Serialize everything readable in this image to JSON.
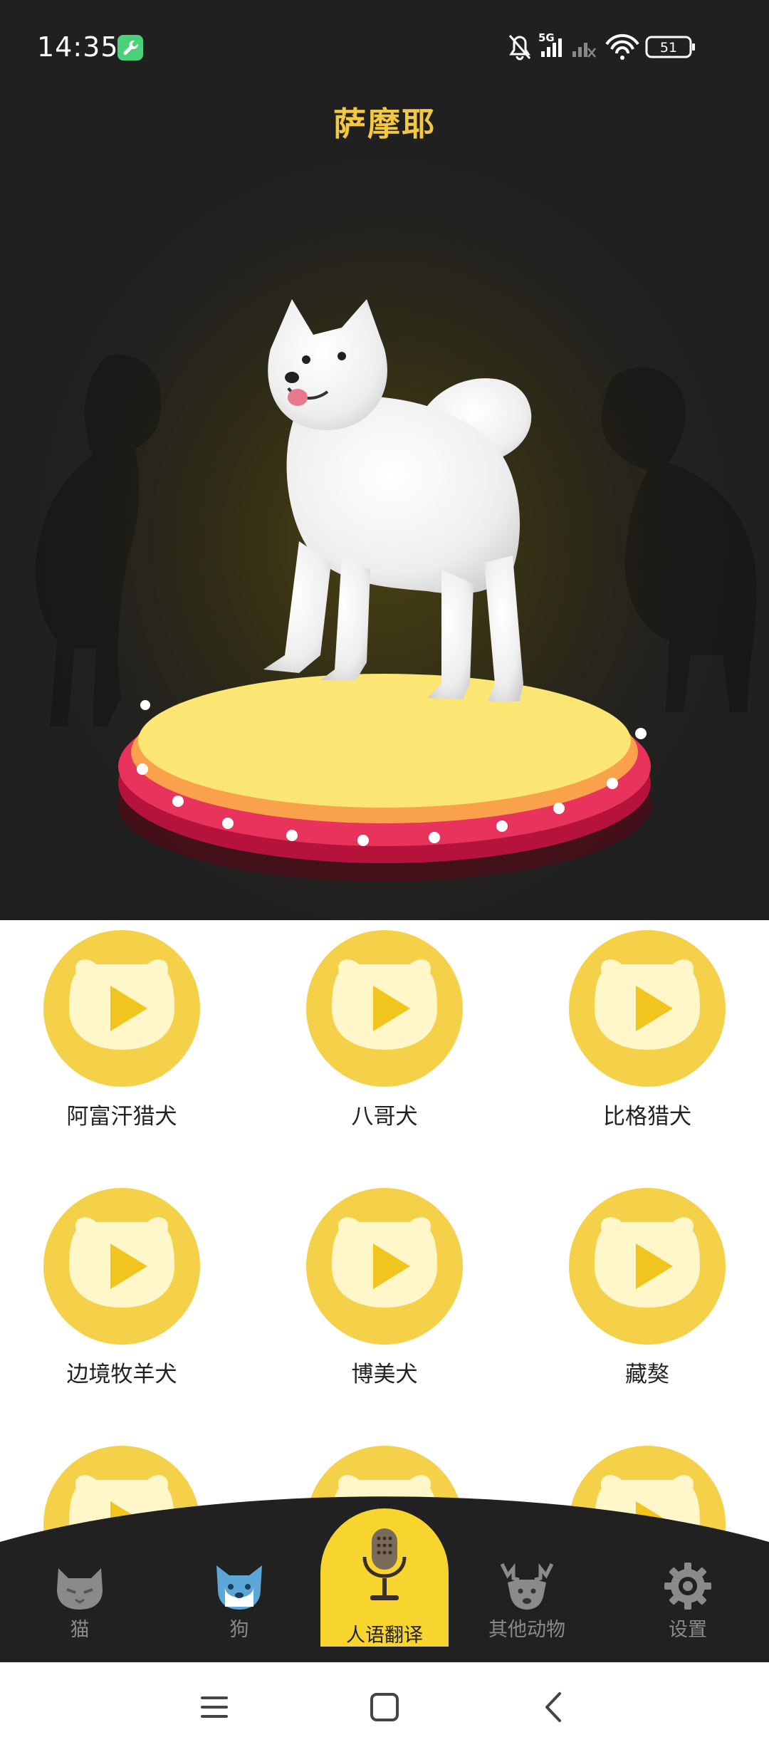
{
  "status_bar": {
    "time": "14:35",
    "network_label": "5G",
    "battery_level": "51",
    "icons": [
      "wrench-app-icon",
      "bell-muted-icon",
      "signal-5g-icon",
      "signal-no-service-icon",
      "wifi-icon",
      "battery-icon"
    ]
  },
  "header": {
    "title": "萨摩耶"
  },
  "grid": {
    "items": [
      {
        "label": "阿富汗猎犬"
      },
      {
        "label": "八哥犬"
      },
      {
        "label": "比格猎犬"
      },
      {
        "label": "边境牧羊犬"
      },
      {
        "label": "博美犬"
      },
      {
        "label": "藏獒"
      },
      {
        "label": ""
      },
      {
        "label": ""
      },
      {
        "label": ""
      }
    ]
  },
  "bottom_nav": {
    "tabs": [
      {
        "label": "猫",
        "icon": "cat-icon"
      },
      {
        "label": "狗",
        "icon": "dog-icon"
      },
      {
        "label": "人语翻译",
        "icon": "microphone-icon",
        "active": true
      },
      {
        "label": "其他动物",
        "icon": "deer-icon"
      },
      {
        "label": "设置",
        "icon": "gear-icon"
      }
    ]
  },
  "system_nav": {
    "icons": [
      "menu-icon",
      "home-icon",
      "back-icon"
    ]
  },
  "colors": {
    "accent_yellow": "#f5d149",
    "title_yellow": "#f4c842",
    "dark_bg": "#222120",
    "platform_red": "#e2345a"
  }
}
